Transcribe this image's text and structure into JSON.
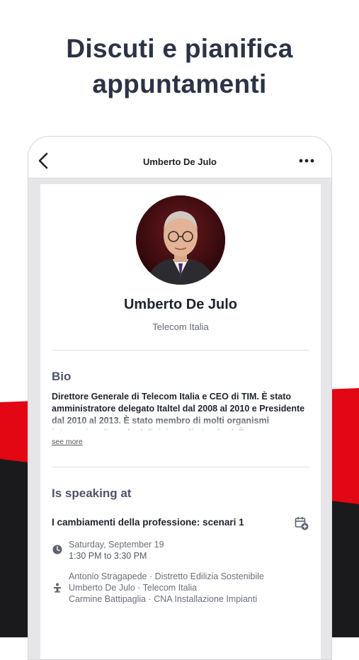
{
  "headline": {
    "line1": "Discuti e pianifica",
    "line2": "appuntamenti"
  },
  "colors": {
    "accent_red": "#e30613",
    "dark": "#1a1a1c",
    "heading": "#2b3345",
    "section": "#4e5468"
  },
  "topbar": {
    "title": "Umberto De Julo",
    "back_icon": "chevron-left-icon",
    "more_icon": "more-horizontal-icon"
  },
  "profile": {
    "name": "Umberto De Julo",
    "company": "Telecom Italia",
    "avatar_icon": "person-photo"
  },
  "bio": {
    "title": "Bio",
    "text": "Direttore Generale di Telecom Italia e CEO di TIM. È stato amministratore delegato Italtel dal 2008 al 2010 e Presidente dal 2010 al 2013. È stato membro di molti organismi internazionali per la definizione di standard. È",
    "see_more": "see more"
  },
  "speaking": {
    "title": "Is speaking at",
    "session": {
      "title": "I cambiamenti della professione: scenari 1",
      "date": "Saturday, September 19",
      "time": "1:30 PM to 3:30 PM",
      "speakers": [
        "Antonio Stragapede · Distretto Edilizia Sostenibile",
        "Umberto De Julo · Telecom Italia",
        "Carmine Battipaglia · CNA Installazione Impianti"
      ],
      "add_icon": "calendar-add-icon",
      "clock_icon": "clock-icon",
      "speaker_icon": "podium-icon"
    }
  }
}
